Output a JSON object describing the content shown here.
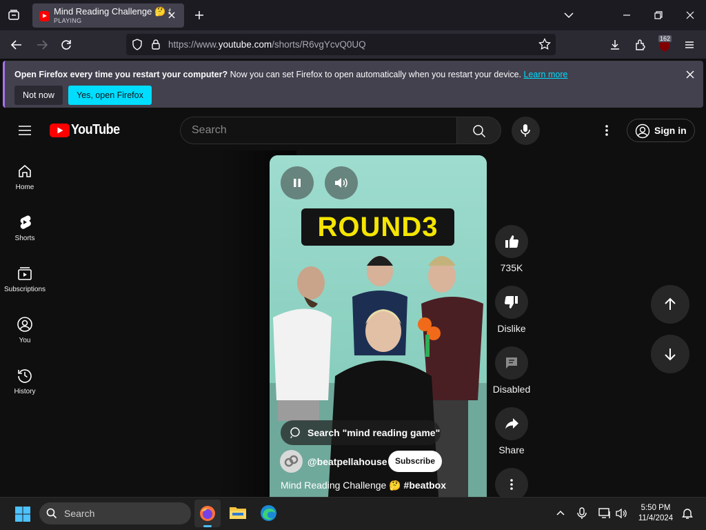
{
  "browser": {
    "tab": {
      "title": "Mind Reading Challenge 🤔 #beatbox",
      "status": "PLAYING"
    },
    "url": {
      "prefix": "https://www.",
      "host": "youtube.com",
      "path": "/shorts/R6vgYcvQ0UQ"
    },
    "extension_badge": "162"
  },
  "notification": {
    "bold": "Open Firefox every time you restart your computer?",
    "text": " Now you can set Firefox to open automatically when you restart your device. ",
    "link": "Learn more",
    "not_now": "Not now",
    "yes_open": "Yes, open Firefox"
  },
  "youtube": {
    "logo_text": "YouTube",
    "search_placeholder": "Search",
    "sign_in": "Sign in",
    "guide": [
      {
        "label": "Home"
      },
      {
        "label": "Shorts"
      },
      {
        "label": "Subscriptions"
      },
      {
        "label": "You"
      },
      {
        "label": "History"
      }
    ],
    "short": {
      "overlay_text": "ROUND3",
      "search_suggestion": "Search \"mind reading game\"",
      "channel": "@beatpellahouse",
      "subscribe": "Subscribe",
      "title": "Mind Reading Challenge 🤔 ",
      "title_tag": "#beatbox"
    },
    "actions": {
      "likes": "735K",
      "dislike": "Dislike",
      "comments": "Disabled",
      "share": "Share"
    }
  },
  "taskbar": {
    "search": "Search",
    "time": "5:50 PM",
    "date": "11/4/2024"
  },
  "colors": {
    "yt_red": "#ff0000",
    "firefox_accent": "#00ddff",
    "overlay_yellow": "#f5e500"
  }
}
